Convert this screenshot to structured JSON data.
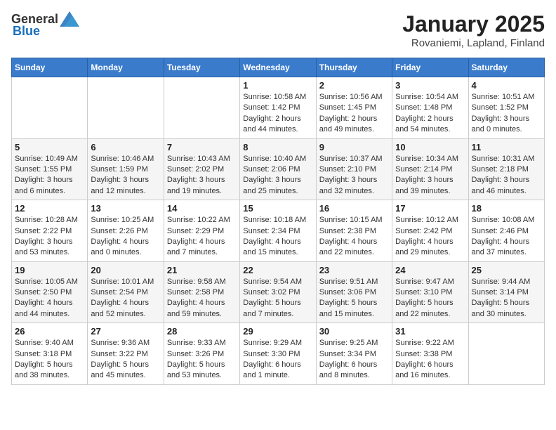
{
  "logo": {
    "general": "General",
    "blue": "Blue"
  },
  "header": {
    "month": "January 2025",
    "location": "Rovaniemi, Lapland, Finland"
  },
  "weekdays": [
    "Sunday",
    "Monday",
    "Tuesday",
    "Wednesday",
    "Thursday",
    "Friday",
    "Saturday"
  ],
  "weeks": [
    [
      {
        "day": "",
        "info": ""
      },
      {
        "day": "",
        "info": ""
      },
      {
        "day": "",
        "info": ""
      },
      {
        "day": "1",
        "info": "Sunrise: 10:58 AM\nSunset: 1:42 PM\nDaylight: 2 hours and 44 minutes."
      },
      {
        "day": "2",
        "info": "Sunrise: 10:56 AM\nSunset: 1:45 PM\nDaylight: 2 hours and 49 minutes."
      },
      {
        "day": "3",
        "info": "Sunrise: 10:54 AM\nSunset: 1:48 PM\nDaylight: 2 hours and 54 minutes."
      },
      {
        "day": "4",
        "info": "Sunrise: 10:51 AM\nSunset: 1:52 PM\nDaylight: 3 hours and 0 minutes."
      }
    ],
    [
      {
        "day": "5",
        "info": "Sunrise: 10:49 AM\nSunset: 1:55 PM\nDaylight: 3 hours and 6 minutes."
      },
      {
        "day": "6",
        "info": "Sunrise: 10:46 AM\nSunset: 1:59 PM\nDaylight: 3 hours and 12 minutes."
      },
      {
        "day": "7",
        "info": "Sunrise: 10:43 AM\nSunset: 2:02 PM\nDaylight: 3 hours and 19 minutes."
      },
      {
        "day": "8",
        "info": "Sunrise: 10:40 AM\nSunset: 2:06 PM\nDaylight: 3 hours and 25 minutes."
      },
      {
        "day": "9",
        "info": "Sunrise: 10:37 AM\nSunset: 2:10 PM\nDaylight: 3 hours and 32 minutes."
      },
      {
        "day": "10",
        "info": "Sunrise: 10:34 AM\nSunset: 2:14 PM\nDaylight: 3 hours and 39 minutes."
      },
      {
        "day": "11",
        "info": "Sunrise: 10:31 AM\nSunset: 2:18 PM\nDaylight: 3 hours and 46 minutes."
      }
    ],
    [
      {
        "day": "12",
        "info": "Sunrise: 10:28 AM\nSunset: 2:22 PM\nDaylight: 3 hours and 53 minutes."
      },
      {
        "day": "13",
        "info": "Sunrise: 10:25 AM\nSunset: 2:26 PM\nDaylight: 4 hours and 0 minutes."
      },
      {
        "day": "14",
        "info": "Sunrise: 10:22 AM\nSunset: 2:29 PM\nDaylight: 4 hours and 7 minutes."
      },
      {
        "day": "15",
        "info": "Sunrise: 10:18 AM\nSunset: 2:34 PM\nDaylight: 4 hours and 15 minutes."
      },
      {
        "day": "16",
        "info": "Sunrise: 10:15 AM\nSunset: 2:38 PM\nDaylight: 4 hours and 22 minutes."
      },
      {
        "day": "17",
        "info": "Sunrise: 10:12 AM\nSunset: 2:42 PM\nDaylight: 4 hours and 29 minutes."
      },
      {
        "day": "18",
        "info": "Sunrise: 10:08 AM\nSunset: 2:46 PM\nDaylight: 4 hours and 37 minutes."
      }
    ],
    [
      {
        "day": "19",
        "info": "Sunrise: 10:05 AM\nSunset: 2:50 PM\nDaylight: 4 hours and 44 minutes."
      },
      {
        "day": "20",
        "info": "Sunrise: 10:01 AM\nSunset: 2:54 PM\nDaylight: 4 hours and 52 minutes."
      },
      {
        "day": "21",
        "info": "Sunrise: 9:58 AM\nSunset: 2:58 PM\nDaylight: 4 hours and 59 minutes."
      },
      {
        "day": "22",
        "info": "Sunrise: 9:54 AM\nSunset: 3:02 PM\nDaylight: 5 hours and 7 minutes."
      },
      {
        "day": "23",
        "info": "Sunrise: 9:51 AM\nSunset: 3:06 PM\nDaylight: 5 hours and 15 minutes."
      },
      {
        "day": "24",
        "info": "Sunrise: 9:47 AM\nSunset: 3:10 PM\nDaylight: 5 hours and 22 minutes."
      },
      {
        "day": "25",
        "info": "Sunrise: 9:44 AM\nSunset: 3:14 PM\nDaylight: 5 hours and 30 minutes."
      }
    ],
    [
      {
        "day": "26",
        "info": "Sunrise: 9:40 AM\nSunset: 3:18 PM\nDaylight: 5 hours and 38 minutes."
      },
      {
        "day": "27",
        "info": "Sunrise: 9:36 AM\nSunset: 3:22 PM\nDaylight: 5 hours and 45 minutes."
      },
      {
        "day": "28",
        "info": "Sunrise: 9:33 AM\nSunset: 3:26 PM\nDaylight: 5 hours and 53 minutes."
      },
      {
        "day": "29",
        "info": "Sunrise: 9:29 AM\nSunset: 3:30 PM\nDaylight: 6 hours and 1 minute."
      },
      {
        "day": "30",
        "info": "Sunrise: 9:25 AM\nSunset: 3:34 PM\nDaylight: 6 hours and 8 minutes."
      },
      {
        "day": "31",
        "info": "Sunrise: 9:22 AM\nSunset: 3:38 PM\nDaylight: 6 hours and 16 minutes."
      },
      {
        "day": "",
        "info": ""
      }
    ]
  ]
}
